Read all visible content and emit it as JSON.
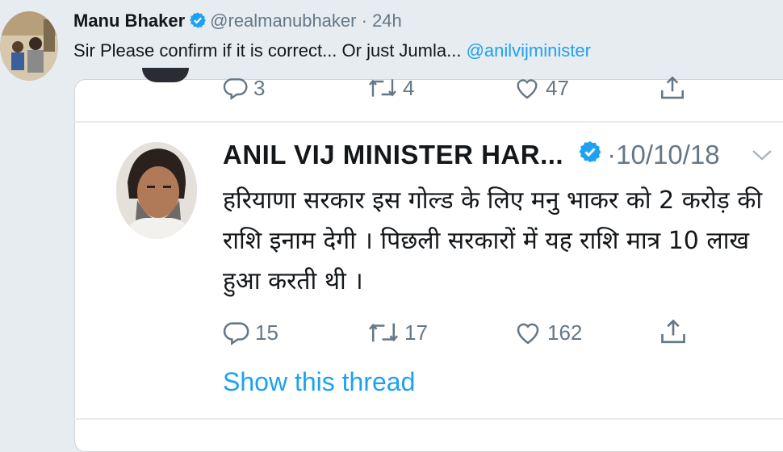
{
  "outer_tweet": {
    "name": "Manu Bhaker",
    "handle": "@realmanubhaker",
    "separator": "·",
    "time": "24h",
    "text": "Sir Please confirm if it is correct... Or just Jumla... ",
    "mention": "@anilvijminister"
  },
  "previous_tweet_actions": {
    "reply_count": "3",
    "retweet_count": "4",
    "like_count": "47"
  },
  "quoted_tweet": {
    "name": "ANIL VIJ MINISTER HAR...",
    "separator": "·",
    "date": "10/10/18",
    "text": "हरियाणा सरकार इस गोल्ड के लिए मनु भाकर को 2 करोड़ की राशि इनाम देगी । पिछली सरकारों में यह राशि मात्र 10 लाख हुआ करती थी ।",
    "reply_count": "15",
    "retweet_count": "17",
    "like_count": "162",
    "show_thread": "Show this thread"
  },
  "colors": {
    "background": "#e6ecf0",
    "link": "#1da1f2",
    "secondary_text": "#657786",
    "verified": "#1da1f2"
  },
  "icons": [
    "reply-icon",
    "retweet-icon",
    "like-icon",
    "share-icon",
    "verified-badge-icon",
    "chevron-down-icon"
  ]
}
